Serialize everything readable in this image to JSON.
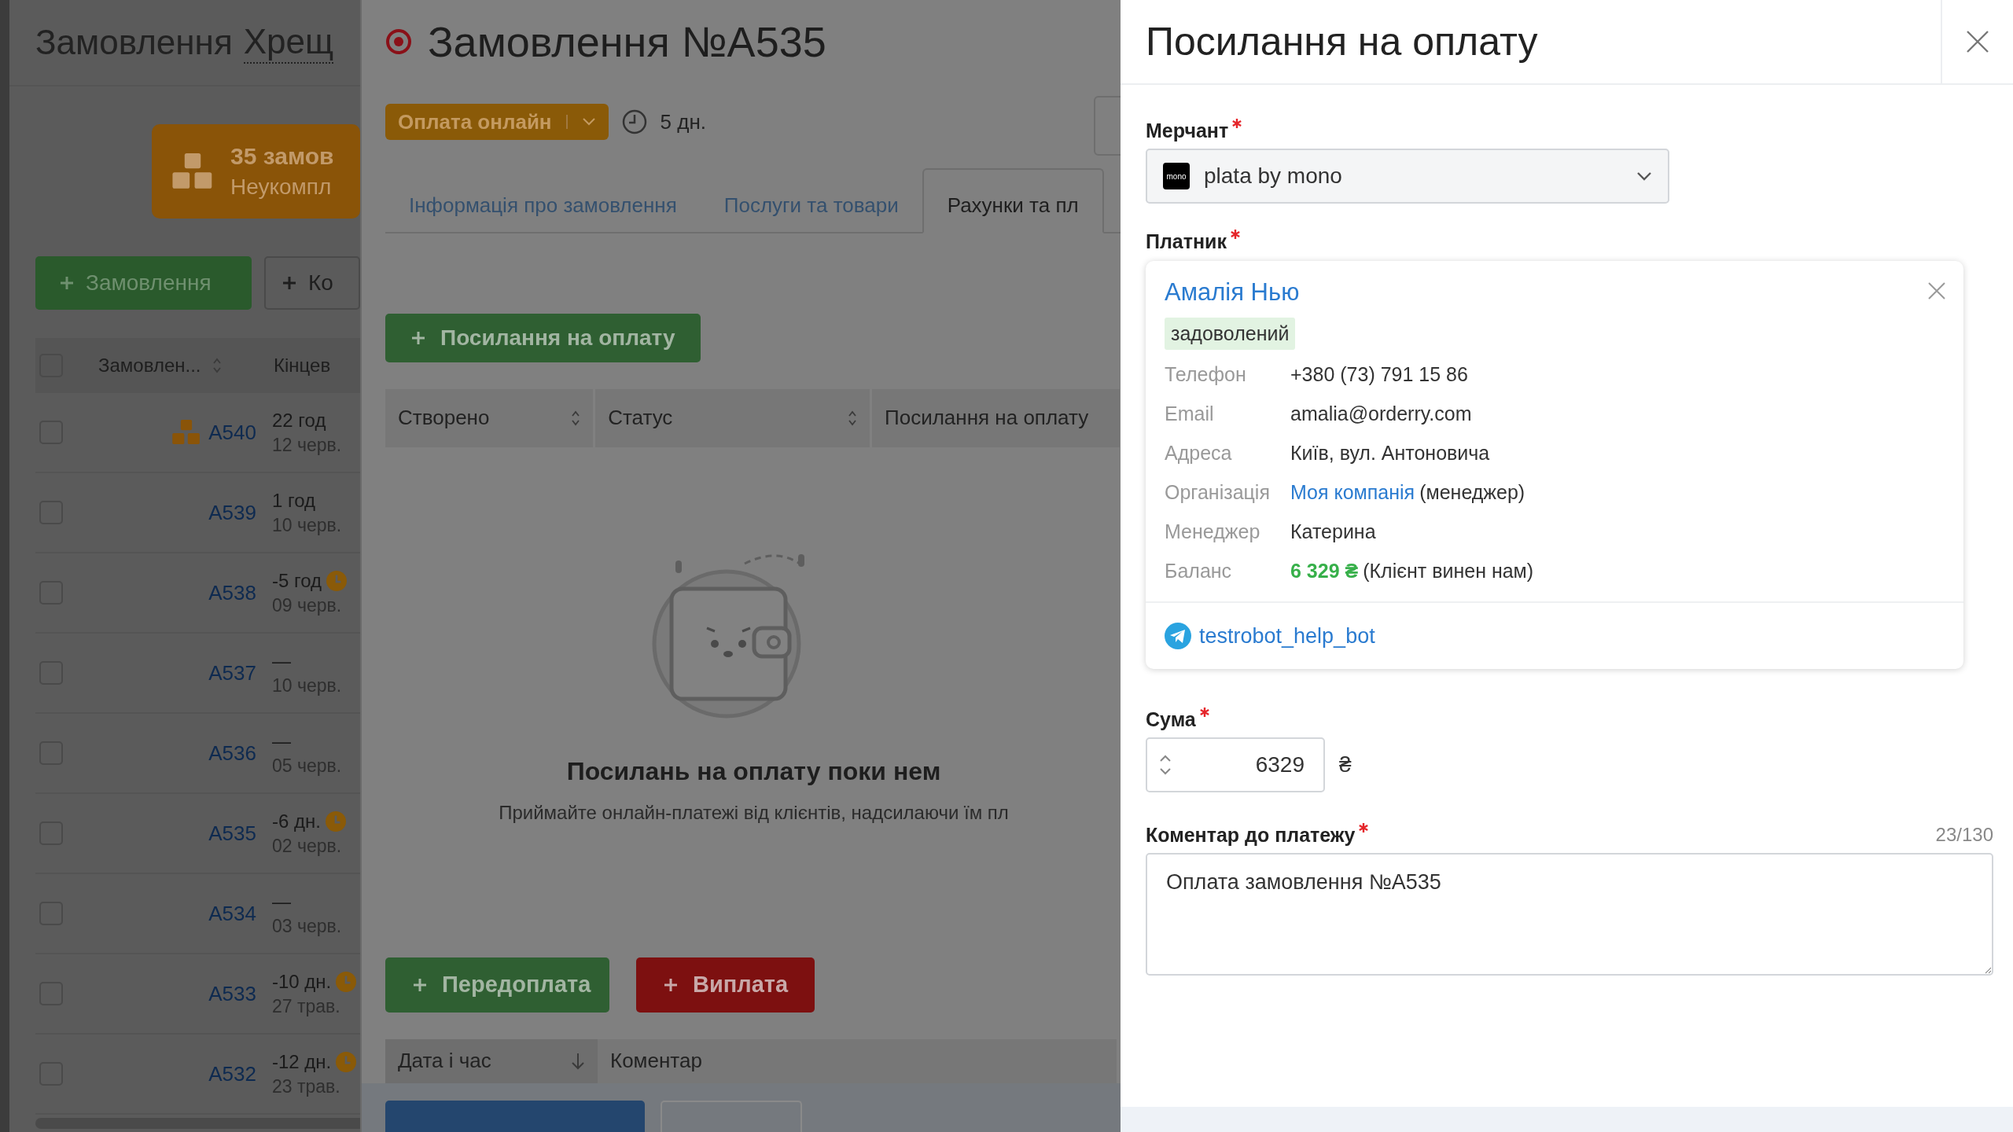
{
  "background_page": {
    "title": "Замовлення",
    "filter": "Хрещ",
    "summary_card": {
      "count": "35 замов",
      "subtitle": "Неукомпл"
    },
    "buttons": [
      {
        "label": "Замовлення",
        "kind": "primary"
      },
      {
        "label": "Ко",
        "kind": "outline"
      }
    ],
    "table": {
      "columns": [
        "Замовлен...",
        "Кінцев"
      ],
      "all_checked": false,
      "rows": [
        {
          "order": "A540",
          "due": "22 год",
          "date": "12 черв.",
          "checked": false,
          "bundle": true,
          "overdue": false
        },
        {
          "order": "A539",
          "due": "1 год",
          "date": "10 черв.",
          "checked": false,
          "bundle": false,
          "overdue": false
        },
        {
          "order": "A538",
          "due": "-5 год",
          "date": "09 черв.",
          "checked": false,
          "bundle": false,
          "overdue": true
        },
        {
          "order": "A537",
          "due": "—",
          "date": "10 черв.",
          "checked": false,
          "bundle": false,
          "overdue": false
        },
        {
          "order": "A536",
          "due": "—",
          "date": "05 черв.",
          "checked": false,
          "bundle": false,
          "overdue": false
        },
        {
          "order": "A535",
          "due": "-6 дн.",
          "date": "02 черв.",
          "checked": false,
          "bundle": false,
          "overdue": true
        },
        {
          "order": "A534",
          "due": "—",
          "date": "03 черв.",
          "checked": false,
          "bundle": false,
          "overdue": false
        },
        {
          "order": "A533",
          "due": "-10 дн.",
          "date": "27 трав.",
          "checked": false,
          "bundle": false,
          "overdue": true
        },
        {
          "order": "A532",
          "due": "-12 дн.",
          "date": "23 трав.",
          "checked": false,
          "bundle": false,
          "overdue": true
        }
      ]
    }
  },
  "order_modal": {
    "title": "Замовлення №A535",
    "status": "Оплата онлайн",
    "duration": "5 дн.",
    "tabs": [
      {
        "label": "Інформація про замовлення",
        "selected": false
      },
      {
        "label": "Послуги та товари",
        "selected": false
      },
      {
        "label": "Рахунки та пл",
        "selected": true
      }
    ],
    "add_link_button": "Посилання на оплату",
    "links_table": {
      "columns": [
        {
          "label": "Створено",
          "sortable": true
        },
        {
          "label": "Статус",
          "sortable": true
        },
        {
          "label": "Посилання на оплату",
          "sortable": false
        }
      ]
    },
    "empty_state": {
      "heading": "Посилань на оплату поки нем",
      "text": "Приймайте онлайн-платежі від клієнтів, надсилаючи їм пл"
    },
    "actions": [
      {
        "label": "Передоплата",
        "kind": "prepay"
      },
      {
        "label": "Виплата",
        "kind": "payout"
      }
    ],
    "payments_table": {
      "columns": [
        {
          "label": "Дата і час",
          "sorted": true
        },
        {
          "label": "Коментар",
          "sorted": false
        }
      ]
    }
  },
  "payment_link_panel": {
    "title": "Посилання на оплату",
    "merchant": {
      "label": "Мерчант",
      "required": true,
      "logo_text": "mono",
      "value": "plata by mono"
    },
    "payer": {
      "label": "Платник",
      "required": true,
      "name": "Амалія Нью",
      "tag": "задоволений",
      "fields": [
        {
          "label": "Телефон",
          "kind": "text",
          "value": "+380 (73) 791 15 86"
        },
        {
          "label": "Email",
          "kind": "text",
          "value": "amalia@orderry.com"
        },
        {
          "label": "Адреса",
          "kind": "text",
          "value": "Київ, вул. Антоновича"
        },
        {
          "label": "Організація",
          "kind": "link",
          "link": "Моя компанія",
          "value": "(менеджер)"
        },
        {
          "label": "Менеджер",
          "kind": "text",
          "value": "Катерина"
        },
        {
          "label": "Баланс",
          "kind": "amount",
          "amount": "6 329 ₴",
          "value": "(Клієнт винен нам)"
        }
      ],
      "telegram": "testrobot_help_bot"
    },
    "amount": {
      "label": "Сума",
      "required": true,
      "value": "6329",
      "currency": "₴"
    },
    "comment": {
      "label": "Коментар до платежу",
      "required": true,
      "counter": "23/130",
      "value": "Оплата замовлення №A535"
    }
  }
}
